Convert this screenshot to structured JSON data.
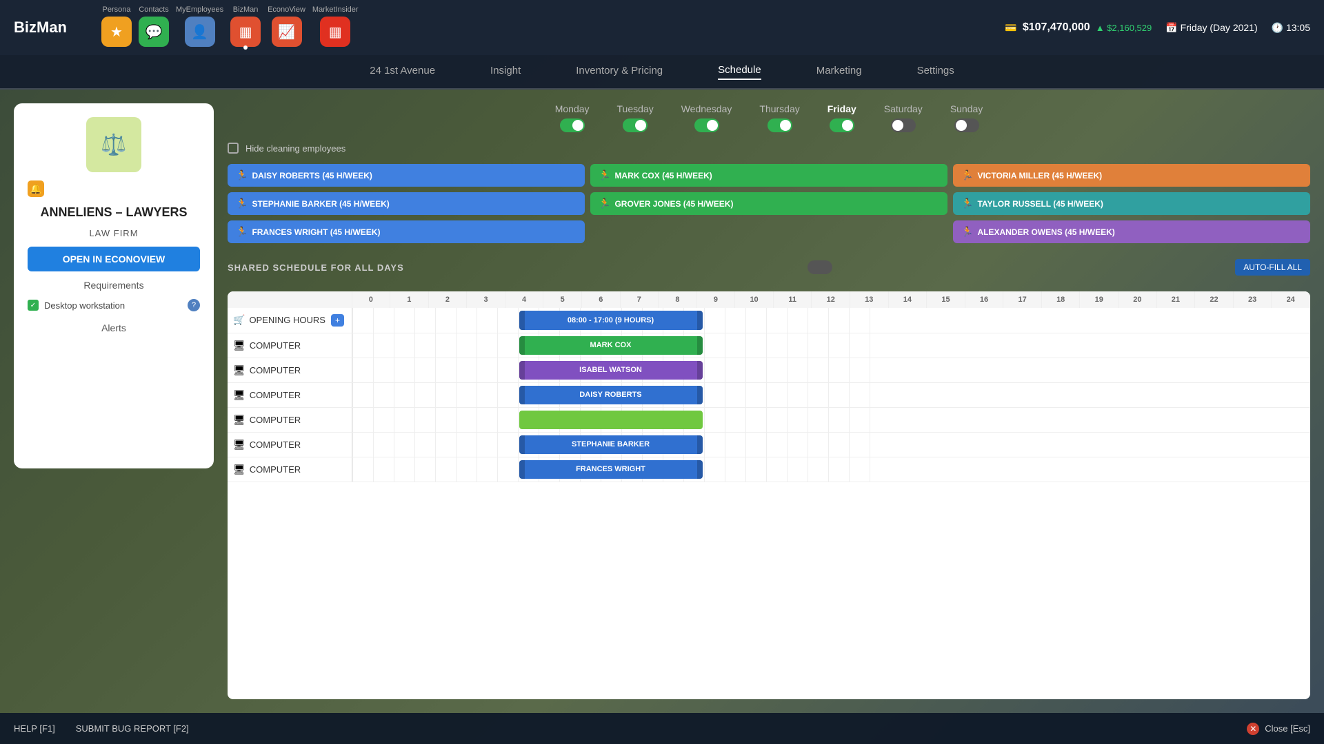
{
  "app": {
    "logo": "BizMan"
  },
  "nav": {
    "items": [
      {
        "label": "Persona",
        "icon": "★",
        "color": "star"
      },
      {
        "label": "Contacts",
        "icon": "💬",
        "color": "chat"
      },
      {
        "label": "MyEmployees",
        "icon": "👤",
        "color": "person"
      },
      {
        "label": "BizMan",
        "icon": "▦",
        "color": "grid"
      },
      {
        "label": "EconoView",
        "icon": "📈",
        "color": "chart"
      },
      {
        "label": "MarketInsider",
        "icon": "▦",
        "color": "market"
      }
    ]
  },
  "topright": {
    "money_icon": "💳",
    "money_amount": "$107,470,000",
    "money_delta": "▲ $2,160,529",
    "calendar_icon": "📅",
    "date": "Friday (Day 2021)",
    "clock_icon": "🕐",
    "time": "13:05"
  },
  "subnav": {
    "items": [
      {
        "label": "24 1st Avenue",
        "active": false
      },
      {
        "label": "Insight",
        "active": false
      },
      {
        "label": "Inventory & Pricing",
        "active": false
      },
      {
        "label": "Schedule",
        "active": true
      },
      {
        "label": "Marketing",
        "active": false
      },
      {
        "label": "Settings",
        "active": false
      }
    ]
  },
  "leftpanel": {
    "firm_name": "ANNELIENS – LAWYERS",
    "firm_type": "LAW FIRM",
    "open_btn": "OPEN IN ECONOVIEW",
    "requirements_title": "Requirements",
    "requirement_item": "Desktop workstation",
    "alerts_title": "Alerts"
  },
  "schedule": {
    "days": [
      {
        "label": "Monday",
        "on": true,
        "active": false
      },
      {
        "label": "Tuesday",
        "on": true,
        "active": false
      },
      {
        "label": "Wednesday",
        "on": true,
        "active": false
      },
      {
        "label": "Thursday",
        "on": true,
        "active": false
      },
      {
        "label": "Friday",
        "on": true,
        "active": true
      },
      {
        "label": "Saturday",
        "on": false,
        "active": false
      },
      {
        "label": "Sunday",
        "on": false,
        "active": false
      }
    ],
    "hide_cleaning_label": "Hide cleaning employees",
    "employees": [
      {
        "name": "DAISY ROBERTS (45 H/WEEK)",
        "color": "blue"
      },
      {
        "name": "MARK COX (45 H/WEEK)",
        "color": "green"
      },
      {
        "name": "VICTORIA MILLER (45 H/WEEK)",
        "color": "orange"
      },
      {
        "name": "STEPHANIE BARKER (45 H/WEEK)",
        "color": "blue"
      },
      {
        "name": "GROVER JONES (45 H/WEEK)",
        "color": "green"
      },
      {
        "name": "TAYLOR RUSSELL (45 H/WEEK)",
        "color": "teal"
      },
      {
        "name": "FRANCES WRIGHT (45 H/WEEK)",
        "color": "blue"
      },
      {
        "name": "",
        "color": "blue"
      },
      {
        "name": "ALEXANDER OWENS (45 H/WEEK)",
        "color": "purple"
      }
    ],
    "shared_schedule_label": "SHARED SCHEDULE FOR ALL DAYS",
    "auto_fill_btn": "AUTO-FILL ALL",
    "hours": [
      0,
      1,
      2,
      3,
      4,
      5,
      6,
      7,
      8,
      9,
      10,
      11,
      12,
      13,
      14,
      15,
      16,
      17,
      18,
      19,
      20,
      21,
      22,
      23,
      24
    ],
    "rows": [
      {
        "type": "OPENING HOURS",
        "bar_label": "08:00 - 17:00 (9 HOURS)",
        "bar_color": "blue",
        "bar_start": 8,
        "bar_end": 17
      },
      {
        "type": "COMPUTER",
        "bar_label": "MARK COX",
        "bar_color": "green",
        "bar_start": 8,
        "bar_end": 17
      },
      {
        "type": "COMPUTER",
        "bar_label": "ISABEL WATSON",
        "bar_color": "purple",
        "bar_start": 8,
        "bar_end": 17
      },
      {
        "type": "COMPUTER",
        "bar_label": "DAISY ROBERTS",
        "bar_color": "blue",
        "bar_start": 8,
        "bar_end": 17
      },
      {
        "type": "COMPUTER",
        "bar_label": "",
        "bar_color": "light-green",
        "bar_start": 8,
        "bar_end": 17
      },
      {
        "type": "COMPUTER",
        "bar_label": "STEPHANIE BARKER",
        "bar_color": "blue",
        "bar_start": 8,
        "bar_end": 17
      },
      {
        "type": "COMPUTER",
        "bar_label": "FRANCES WRIGHT",
        "bar_color": "blue",
        "bar_start": 8,
        "bar_end": 17
      }
    ]
  },
  "bottom": {
    "help_label": "HELP [F1]",
    "bug_label": "SUBMIT BUG REPORT [F2]",
    "close_label": "Close [Esc]"
  }
}
